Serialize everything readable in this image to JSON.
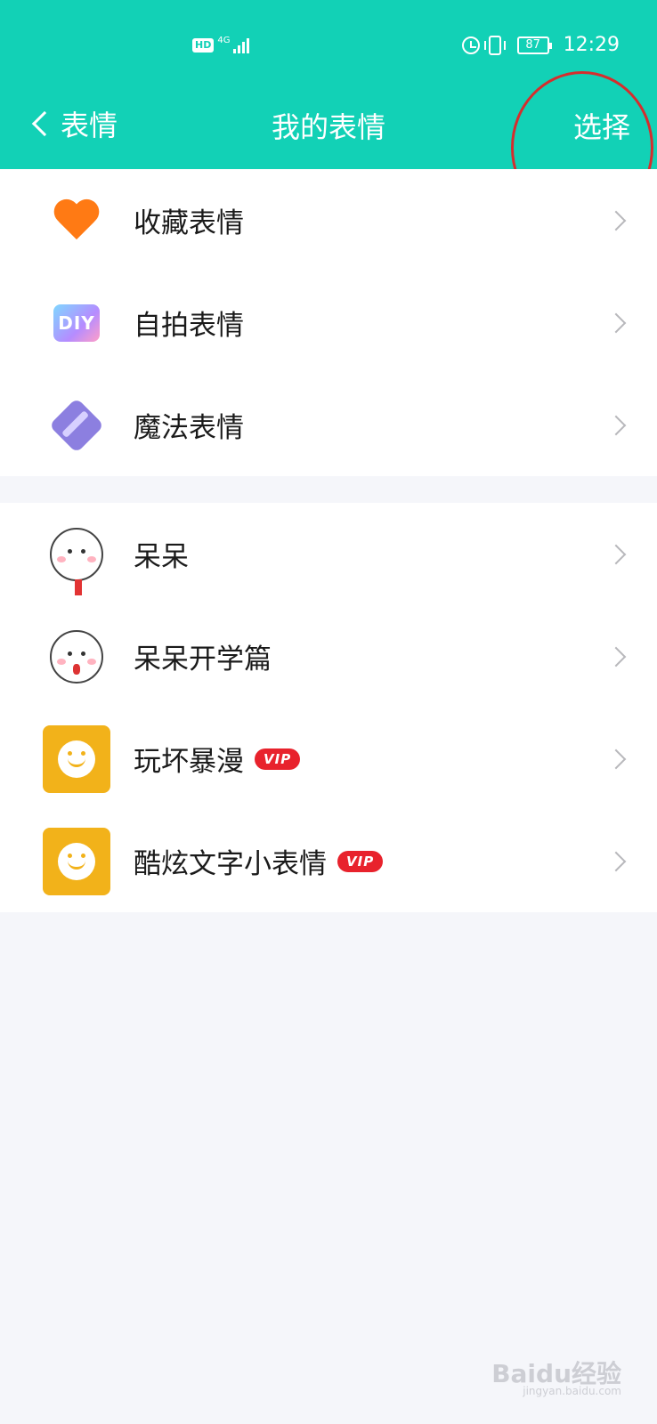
{
  "status_bar": {
    "network_badge": "HD",
    "network_type": "4G",
    "battery": "87",
    "time": "12:29"
  },
  "navbar": {
    "back_label": "表情",
    "title": "我的表情",
    "action_label": "选择"
  },
  "system_items": [
    {
      "label": "收藏表情",
      "icon": "heart-icon"
    },
    {
      "label": "自拍表情",
      "icon": "diy-icon"
    },
    {
      "label": "魔法表情",
      "icon": "magic-wand-icon"
    }
  ],
  "diy_icon_text": "DIY",
  "sticker_items": [
    {
      "label": "呆呆",
      "icon": "cartoon-face-icon",
      "vip": ""
    },
    {
      "label": "呆呆开学篇",
      "icon": "cartoon-face-icon",
      "vip": ""
    },
    {
      "label": "玩坏暴漫",
      "icon": "yellow-smile-icon",
      "vip": "VIP"
    },
    {
      "label": "酷炫文字小表情",
      "icon": "yellow-smile-icon",
      "vip": "VIP"
    }
  ],
  "watermark": {
    "text": "Baidu经验",
    "url_text": "jingyan.baidu.com"
  },
  "colors": {
    "header": "#12d1b6",
    "annotation_ring": "#d62d2d",
    "vip": "#e8222c"
  }
}
